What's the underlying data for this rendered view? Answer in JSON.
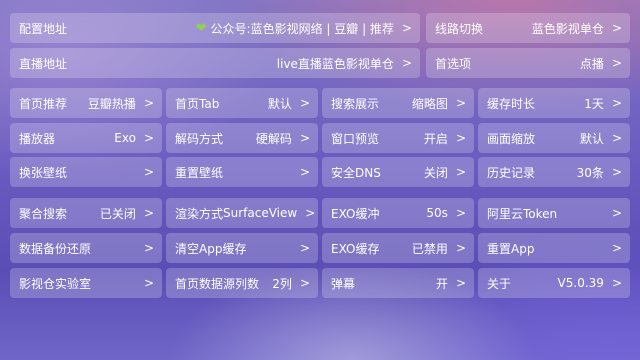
{
  "rows": {
    "config_address": {
      "label": "配置地址",
      "value": "公众号:蓝色影视网络 | 豆瓣 | 推荐",
      "arrow": ">"
    },
    "line_switch": {
      "label": "线路切换",
      "value": "蓝色影视单仓",
      "arrow": ">"
    },
    "live_address": {
      "label": "直播地址",
      "value": "live直播蓝色影视单仓",
      "arrow": ">"
    },
    "preferred": {
      "label": "首选项",
      "value": "点播",
      "arrow": ">"
    }
  },
  "grid": [
    {
      "label": "首页推荐",
      "value": "豆瓣热播",
      "arrow": ">"
    },
    {
      "label": "首页Tab",
      "value": "默认",
      "arrow": ">"
    },
    {
      "label": "搜索展示",
      "value": "缩略图",
      "arrow": ">"
    },
    {
      "label": "缓存时长",
      "value": "1天",
      "arrow": ">"
    },
    {
      "label": "播放器",
      "value": "Exo",
      "arrow": ">"
    },
    {
      "label": "解码方式",
      "value": "硬解码",
      "arrow": ">"
    },
    {
      "label": "窗口预览",
      "value": "开启",
      "arrow": ">"
    },
    {
      "label": "画面缩放",
      "value": "默认",
      "arrow": ">"
    },
    {
      "label": "换张壁纸",
      "value": "",
      "arrow": ">"
    },
    {
      "label": "重置壁纸",
      "value": "",
      "arrow": ">"
    },
    {
      "label": "安全DNS",
      "value": "关闭",
      "arrow": ">"
    },
    {
      "label": "历史记录",
      "value": "30条",
      "arrow": ">"
    },
    {
      "label": "聚合搜索",
      "value": "已关闭",
      "arrow": ">"
    },
    {
      "label": "渲染方式",
      "value": "SurfaceView",
      "arrow": ">"
    },
    {
      "label": "EXO缓冲",
      "value": "50s",
      "arrow": ">"
    },
    {
      "label": "阿里云Token",
      "value": "",
      "arrow": ">"
    },
    {
      "label": "数据备份还原",
      "value": "",
      "arrow": ">"
    },
    {
      "label": "清空App缓存",
      "value": "",
      "arrow": ">"
    },
    {
      "label": "EXO缓存",
      "value": "已禁用",
      "arrow": ">"
    },
    {
      "label": "重置App",
      "value": "",
      "arrow": ">"
    },
    {
      "label": "影视仓实验室",
      "value": "",
      "arrow": ">"
    },
    {
      "label": "首页数据源列数",
      "value": "2列",
      "arrow": ">"
    },
    {
      "label": "弹幕",
      "value": "开",
      "arrow": ">"
    },
    {
      "label": "关于",
      "value": "V5.0.39",
      "arrow": ">"
    }
  ],
  "icons": {
    "config_address_prefix": "heart-icon"
  },
  "colors": {
    "heart": "#8fd14f",
    "text": "#ffffff"
  }
}
